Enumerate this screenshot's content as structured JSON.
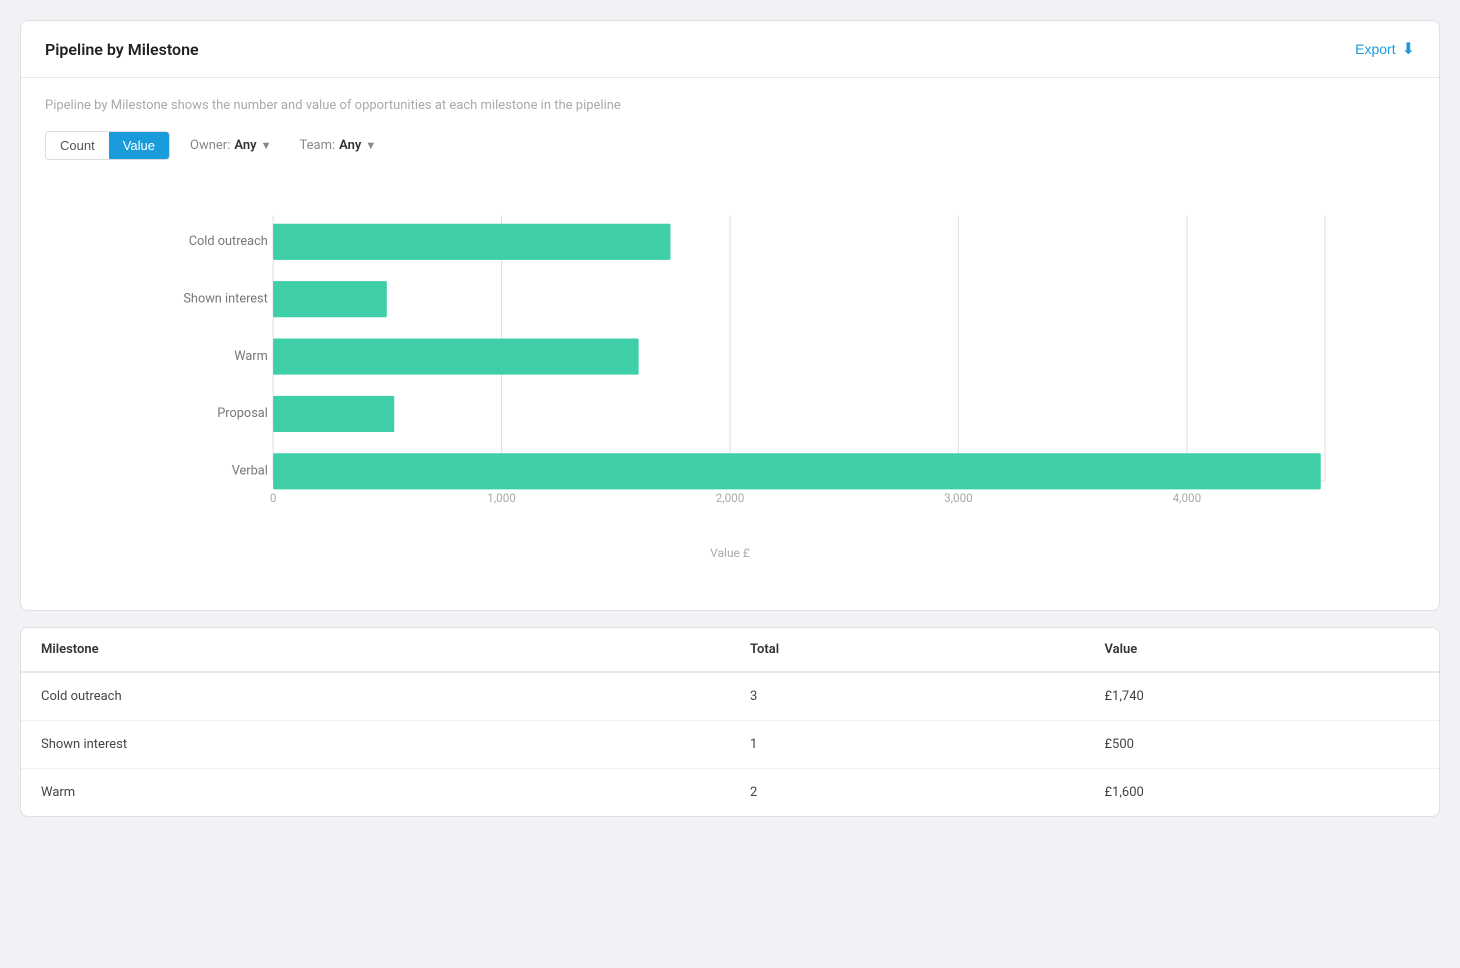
{
  "page": {
    "background": "#f0f2f5"
  },
  "chart_card": {
    "title": "Pipeline by Milestone",
    "export_label": "Export",
    "description": "Pipeline by Milestone shows the number and value of opportunities at each milestone in the pipeline",
    "filters": {
      "count_label": "Count",
      "value_label": "Value",
      "active": "Value",
      "owner_label": "Owner:",
      "owner_value": "Any",
      "team_label": "Team:",
      "team_value": "Any"
    },
    "x_axis_label": "Value £",
    "x_axis_ticks": [
      "0",
      "1,000",
      "2,000",
      "3,000",
      "4,000"
    ],
    "bars": [
      {
        "label": "Cold outreach",
        "value": 1740,
        "max": 4600
      },
      {
        "label": "Shown interest",
        "value": 500,
        "max": 4600
      },
      {
        "label": "Warm",
        "value": 1600,
        "max": 4600
      },
      {
        "label": "Proposal",
        "value": 530,
        "max": 4600
      },
      {
        "label": "Verbal",
        "value": 4580,
        "max": 4600
      }
    ],
    "bar_color": "#3ecfa8"
  },
  "table_card": {
    "columns": {
      "milestone": "Milestone",
      "total": "Total",
      "value": "Value"
    },
    "rows": [
      {
        "milestone": "Cold outreach",
        "total": "3",
        "value": "£1,740"
      },
      {
        "milestone": "Shown interest",
        "total": "1",
        "value": "£500"
      },
      {
        "milestone": "Warm",
        "total": "2",
        "value": "£1,600"
      }
    ]
  }
}
